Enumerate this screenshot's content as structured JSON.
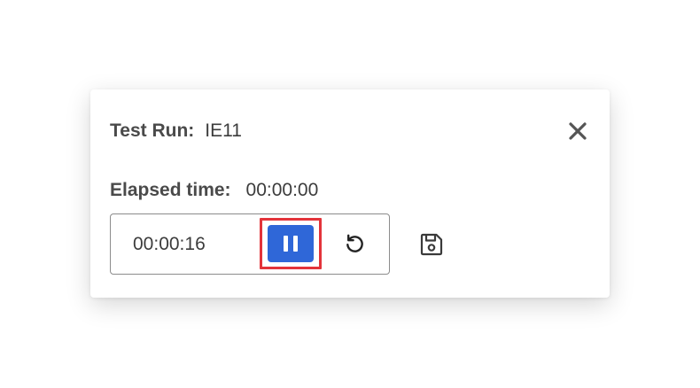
{
  "dialog": {
    "test_run_label": "Test Run:",
    "test_run_value": "IE11",
    "elapsed_label": "Elapsed time:",
    "elapsed_value": "00:00:00",
    "timer_value": "00:00:16",
    "close_icon": "close-icon",
    "pause_icon": "pause-icon",
    "reset_icon": "reset-icon",
    "save_icon": "save-icon"
  },
  "colors": {
    "accent": "#2f67d8",
    "highlight": "#e3333a",
    "text": "#3c3c3c",
    "border": "#8c8c8c"
  }
}
